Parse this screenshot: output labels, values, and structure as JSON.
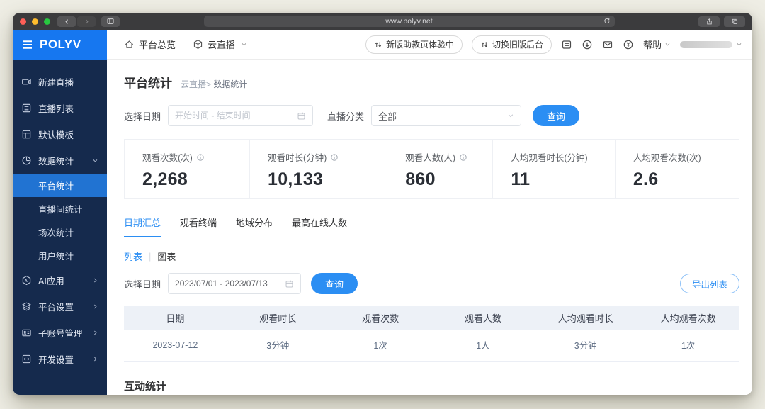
{
  "browser": {
    "url": "www.polyv.net"
  },
  "header": {
    "logo": "POLYV",
    "nav_overview": "平台总览",
    "nav_product": "云直播",
    "pill_new_assistant": "新版助教页体验中",
    "pill_switch_old": "切换旧版后台",
    "help": "帮助"
  },
  "sidebar": {
    "items": [
      {
        "label": "新建直播"
      },
      {
        "label": "直播列表"
      },
      {
        "label": "默认模板"
      },
      {
        "label": "数据统计"
      },
      {
        "label": "AI应用"
      },
      {
        "label": "平台设置"
      },
      {
        "label": "子账号管理"
      },
      {
        "label": "开发设置"
      }
    ],
    "submenu": [
      {
        "label": "平台统计",
        "active": true
      },
      {
        "label": "直播间统计"
      },
      {
        "label": "场次统计"
      },
      {
        "label": "用户统计"
      }
    ]
  },
  "page": {
    "title": "平台统计",
    "breadcrumb_product": "云直播",
    "breadcrumb_sep": ">",
    "breadcrumb_current": "数据统计",
    "filter": {
      "date_label": "选择日期",
      "date_placeholder": "开始时间 - 结束时间",
      "category_label": "直播分类",
      "category_value": "全部",
      "query_button": "查询"
    },
    "stats": [
      {
        "label": "观看次数(次)",
        "value": "2,268",
        "has_info": true
      },
      {
        "label": "观看时长(分钟)",
        "value": "10,133",
        "has_info": true
      },
      {
        "label": "观看人数(人)",
        "value": "860",
        "has_info": true
      },
      {
        "label": "人均观看时长(分钟)",
        "value": "11",
        "has_info": false
      },
      {
        "label": "人均观看次数(次)",
        "value": "2.6",
        "has_info": false
      }
    ],
    "tabs": [
      {
        "label": "日期汇总",
        "active": true
      },
      {
        "label": "观看终端"
      },
      {
        "label": "地域分布"
      },
      {
        "label": "最高在线人数"
      }
    ],
    "view_toggle": {
      "list": "列表",
      "sep": "|",
      "chart": "图表"
    },
    "date_query": {
      "label": "选择日期",
      "value": "2023/07/01 - 2023/07/13",
      "query_button": "查询",
      "export_button": "导出列表"
    },
    "table": {
      "headers": [
        "日期",
        "观看时长",
        "观看次数",
        "观看人数",
        "人均观看时长",
        "人均观看次数"
      ],
      "rows": [
        [
          "2023-07-12",
          "3分钟",
          "1次",
          "1人",
          "3分钟",
          "1次"
        ]
      ]
    },
    "section_interaction": "互动统计"
  },
  "colors": {
    "brand_blue": "#1677f0",
    "accent_blue": "#2b8ef3",
    "sidebar_navy": "#152a4d",
    "active_item_blue": "#2173d2",
    "table_header_bg": "#edf1f7"
  }
}
